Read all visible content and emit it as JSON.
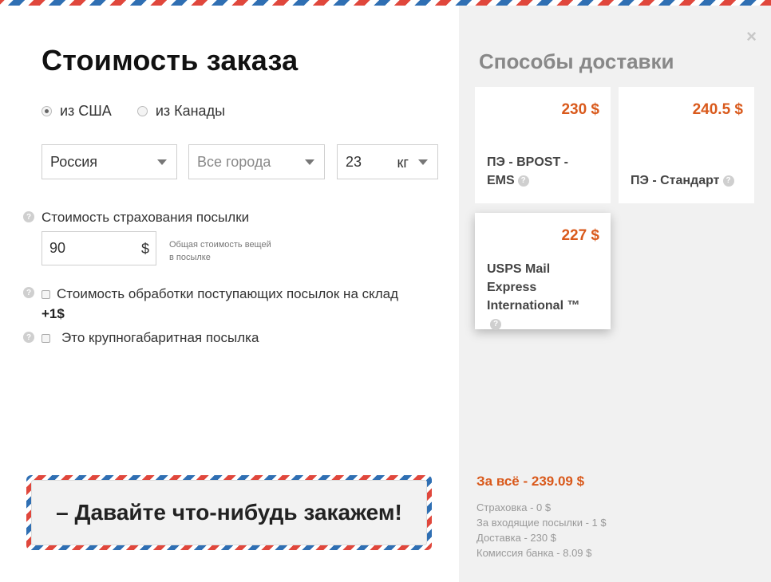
{
  "title": "Стоимость заказа",
  "origin": {
    "options": [
      {
        "label": "из США",
        "checked": true
      },
      {
        "label": "из Канады",
        "checked": false
      }
    ]
  },
  "filters": {
    "country": "Россия",
    "city_placeholder": "Все города",
    "weight_value": "23",
    "weight_unit": "кг"
  },
  "insurance": {
    "label": "Стоимость страхования посылки",
    "value": "90",
    "currency": "$",
    "note": "Общая стоимость вещей в посылке"
  },
  "options": {
    "processing_label": "Стоимость обработки поступающих посылок на склад",
    "processing_price": "+1$",
    "oversize_label": "Это крупногабаритная посылка"
  },
  "order_button": "– Давайте что-нибудь закажем!",
  "delivery": {
    "title": "Способы доставки",
    "close": "×",
    "methods": [
      {
        "price": "230 $",
        "name": "ПЭ - BPOST - EMS"
      },
      {
        "price": "240.5 $",
        "name": "ПЭ - Стандарт"
      },
      {
        "price": "227 $",
        "name": "USPS Mail Express International ™"
      }
    ]
  },
  "summary": {
    "total": "За всё - 239.09 $",
    "lines": [
      "Страховка - 0 $",
      "За входящие посылки - 1 $",
      "Доставка - 230 $",
      "Комиссия банка - 8.09 $"
    ]
  },
  "colors": {
    "accent": "#d9591b",
    "stripe_red": "#e0473c",
    "stripe_blue": "#2f6fb3"
  }
}
